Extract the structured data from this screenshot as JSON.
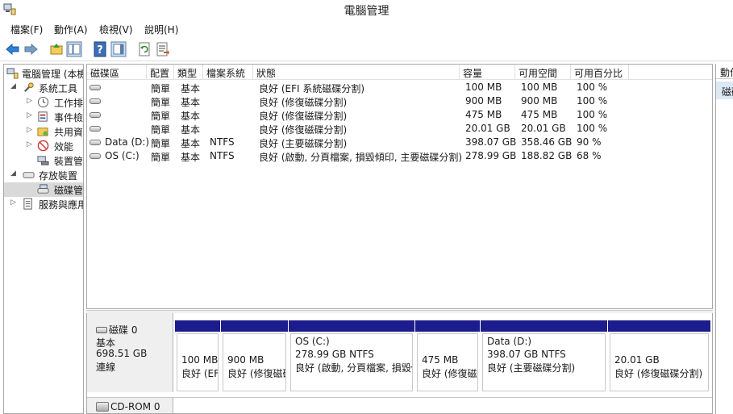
{
  "window": {
    "title": "電腦管理"
  },
  "menu": [
    "檔案(F)",
    "動作(A)",
    "檢視(V)",
    "說明(H)"
  ],
  "toolbar": {
    "icons": [
      "back-arrow-icon",
      "forward-arrow-icon",
      "up-folder-icon",
      "show-hide-tree-icon",
      "help-icon",
      "properties-icon",
      "refresh-icon",
      "export-icon"
    ]
  },
  "tree": {
    "root": "電腦管理 (本機",
    "system_tools": "系統工具",
    "task_scheduler": "工作排",
    "event_viewer": "事件檢",
    "shared_folders": "共用資",
    "performance": "效能",
    "device_manager": "裝置管",
    "storage": "存放裝置",
    "disk_management": "磁碟管",
    "services": "服務與應用"
  },
  "volumes": {
    "columns": [
      "磁碟區",
      "配置",
      "類型",
      "檔案系統",
      "狀態",
      "容量",
      "可用空間",
      "可用百分比"
    ],
    "rows": [
      {
        "volume": "",
        "layout": "簡單",
        "type": "基本",
        "fs": "",
        "status": "良好 (EFI 系統磁碟分割)",
        "capacity": "100 MB",
        "free": "100 MB",
        "pct": "100 %"
      },
      {
        "volume": "",
        "layout": "簡單",
        "type": "基本",
        "fs": "",
        "status": "良好 (修復磁碟分割)",
        "capacity": "900 MB",
        "free": "900 MB",
        "pct": "100 %"
      },
      {
        "volume": "",
        "layout": "簡單",
        "type": "基本",
        "fs": "",
        "status": "良好 (修復磁碟分割)",
        "capacity": "475 MB",
        "free": "475 MB",
        "pct": "100 %"
      },
      {
        "volume": "",
        "layout": "簡單",
        "type": "基本",
        "fs": "",
        "status": "良好 (修復磁碟分割)",
        "capacity": "20.01 GB",
        "free": "20.01 GB",
        "pct": "100 %"
      },
      {
        "volume": "Data (D:)",
        "layout": "簡單",
        "type": "基本",
        "fs": "NTFS",
        "status": "良好 (主要磁碟分割)",
        "capacity": "398.07 GB",
        "free": "358.46 GB",
        "pct": "90 %"
      },
      {
        "volume": "OS (C:)",
        "layout": "簡單",
        "type": "基本",
        "fs": "NTFS",
        "status": "良好 (啟動, 分頁檔案, 損毀傾印, 主要磁碟分割)",
        "capacity": "278.99 GB",
        "free": "188.82 GB",
        "pct": "68 %"
      }
    ]
  },
  "actions": {
    "header": "動作",
    "item": "磁碟管理"
  },
  "disk0": {
    "name": "磁碟 0",
    "type": "基本",
    "size": "698.51 GB",
    "status": "連線",
    "partitions": [
      {
        "name": "",
        "size": "100 MB",
        "status": "良好 (EFI 系統磁碟分割)"
      },
      {
        "name": "",
        "size": "900 MB",
        "status": "良好 (修復磁碟分割)"
      },
      {
        "name": "OS  (C:)",
        "size": "278.99 GB NTFS",
        "status": "良好 (啟動, 分頁檔案, 損毀傾印, 主要磁碟分割)"
      },
      {
        "name": "",
        "size": "475 MB",
        "status": "良好 (修復磁碟分割)"
      },
      {
        "name": "Data  (D:)",
        "size": "398.07 GB NTFS",
        "status": "良好 (主要磁碟分割)"
      },
      {
        "name": "",
        "size": "20.01 GB",
        "status": "良好 (修復磁碟分割)"
      }
    ]
  },
  "cdrom": {
    "name": "CD-ROM 0"
  },
  "colors": {
    "partition_bar": "#1c1c8c",
    "selection": "#dde8f5"
  }
}
